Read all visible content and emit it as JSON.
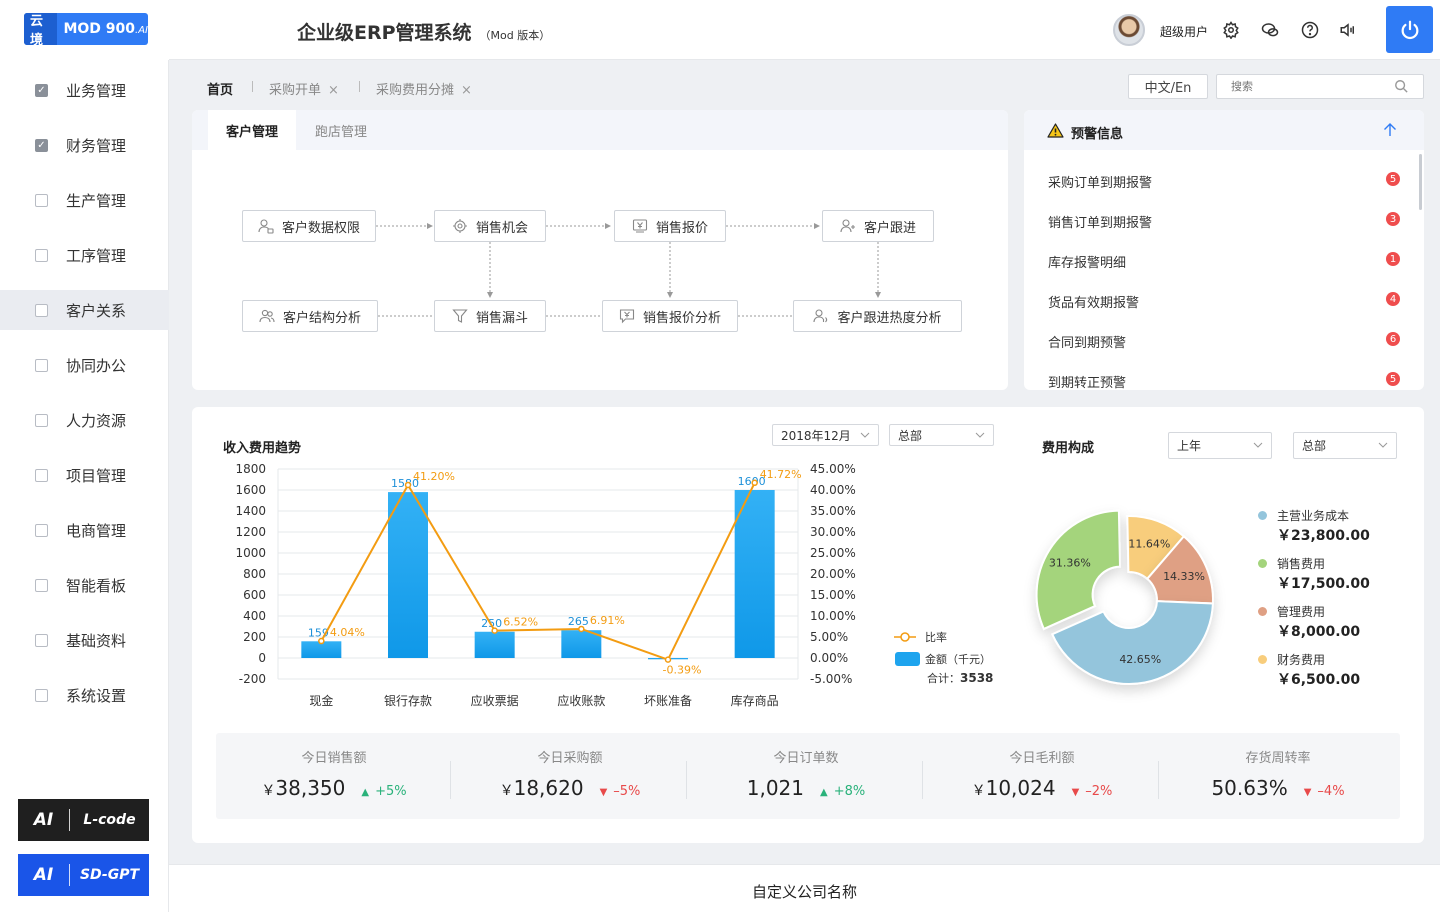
{
  "app": {
    "logo_cn": "云境",
    "logo_mod": "MOD 900",
    "logo_suffix": ".AI",
    "title": "企业级ERP管理系统",
    "title_sub": "（Mod 版本）"
  },
  "header": {
    "username": "超级用户",
    "lang_button": "中文/En",
    "search_placeholder": "搜索"
  },
  "sidebar": {
    "items": [
      {
        "label": "业务管理",
        "checked": true
      },
      {
        "label": "财务管理",
        "checked": true
      },
      {
        "label": "生产管理",
        "checked": false
      },
      {
        "label": "工序管理",
        "checked": false
      },
      {
        "label": "客户关系",
        "checked": false,
        "active": true
      },
      {
        "label": "协同办公",
        "checked": false
      },
      {
        "label": "人力资源",
        "checked": false
      },
      {
        "label": "项目管理",
        "checked": false
      },
      {
        "label": "电商管理",
        "checked": false
      },
      {
        "label": "智能看板",
        "checked": false
      },
      {
        "label": "基础资料",
        "checked": false
      },
      {
        "label": "系统设置",
        "checked": false
      }
    ],
    "ai_buttons": [
      {
        "ai": "AI",
        "name": "L-code",
        "color": "#1f1f1f"
      },
      {
        "ai": "AI",
        "name": "SD-GPT",
        "color": "#1a55e8"
      }
    ]
  },
  "breadcrumbs": {
    "home": "首页",
    "tabs": [
      "采购开单",
      "采购费用分摊"
    ],
    "close": "×"
  },
  "flow": {
    "tabs": [
      "客户管理",
      "跑店管理"
    ],
    "nodes": {
      "n1": "客户数据权限",
      "n2": "销售机会",
      "n3": "销售报价",
      "n4": "客户跟进",
      "n5": "客户结构分析",
      "n6": "销售漏斗",
      "n7": "销售报价分析",
      "n8": "客户跟进热度分析"
    }
  },
  "warnings": {
    "title": "预警信息",
    "items": [
      {
        "label": "采购订单到期报警",
        "count": "5"
      },
      {
        "label": "销售订单到期报警",
        "count": "3"
      },
      {
        "label": "库存报警明细",
        "count": "1"
      },
      {
        "label": "货品有效期报警",
        "count": "4"
      },
      {
        "label": "合同到期预警",
        "count": "6"
      },
      {
        "label": "到期转正预警",
        "count": "5"
      }
    ]
  },
  "trend": {
    "title": "收入费用趋势",
    "filter_month": "2018年12月",
    "filter_scope": "总部",
    "legend_rate": "比率",
    "legend_amount": "金额（千元）",
    "total_label": "合计：",
    "total_value": "3538"
  },
  "cost": {
    "title": "费用构成",
    "filter_period": "上年",
    "filter_scope": "总部",
    "items": [
      {
        "name": "主营业务成本",
        "value": "￥23,800.00",
        "color": "#94c5dc"
      },
      {
        "name": "销售费用",
        "value": "￥17,500.00",
        "color": "#a4d47c"
      },
      {
        "name": "管理费用",
        "value": "￥8,000.00",
        "color": "#dfa084"
      },
      {
        "name": "财务费用",
        "value": "￥6,500.00",
        "color": "#f8cd7c"
      }
    ]
  },
  "stats": [
    {
      "label": "今日销售额",
      "currency": "￥",
      "value": "38,350",
      "change": "+5%",
      "dir": "up"
    },
    {
      "label": "今日采购额",
      "currency": "￥",
      "value": "18,620",
      "change": "–5%",
      "dir": "down"
    },
    {
      "label": "今日订单数",
      "currency": "",
      "value": "1,021",
      "change": "+8%",
      "dir": "up"
    },
    {
      "label": "今日毛利额",
      "currency": "￥",
      "value": "10,024",
      "change": "–2%",
      "dir": "down"
    },
    {
      "label": "存货周转率",
      "currency": "",
      "value": "50.63%",
      "change": "–4%",
      "dir": "down"
    }
  ],
  "footer": {
    "company": "自定义公司名称"
  },
  "chart_data": [
    {
      "type": "bar",
      "title": "收入费用趋势",
      "categories": [
        "现金",
        "银行存款",
        "应收票据",
        "应收账款",
        "坏账准备",
        "库存商品"
      ],
      "series": [
        {
          "name": "金额（千元）",
          "type": "bar",
          "axis": "left",
          "values": [
            159,
            1580,
            250,
            265,
            -12,
            1600
          ],
          "labels": [
            "159",
            "1580",
            "250",
            "265",
            "",
            "1600"
          ]
        },
        {
          "name": "比率",
          "type": "line",
          "axis": "right",
          "values": [
            4.04,
            41.2,
            6.52,
            6.91,
            -0.39,
            41.72
          ],
          "labels": [
            "4.04%",
            "41.20%",
            "6.52%",
            "6.91%",
            "-0.39%",
            "41.72%"
          ]
        }
      ],
      "y_left": {
        "min": -200,
        "max": 1800,
        "step": 200
      },
      "y_right": {
        "min": -5,
        "max": 45,
        "step": 5,
        "suffix": "%"
      },
      "legend_position": "right",
      "grid": true
    },
    {
      "type": "pie",
      "title": "费用构成",
      "donut": true,
      "slices": [
        {
          "name": "主营业务成本",
          "percent": 42.65,
          "label": "42.65%",
          "color": "#94c5dc"
        },
        {
          "name": "销售费用",
          "percent": 31.36,
          "label": "31.36%",
          "color": "#a4d47c",
          "exploded": true
        },
        {
          "name": "财务费用",
          "percent": 11.64,
          "label": "11.64%",
          "color": "#f8cd7c"
        },
        {
          "name": "管理费用",
          "percent": 14.33,
          "label": "14.33%",
          "color": "#dfa084"
        }
      ],
      "legend_position": "right"
    }
  ]
}
